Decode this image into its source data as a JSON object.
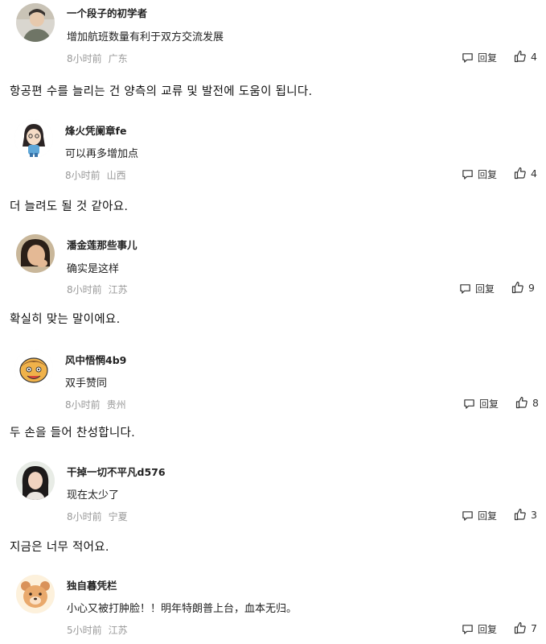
{
  "comments": [
    {
      "username": "一个段子的初学者",
      "text": "增加航班数量有利于双方交流发展",
      "time": "8小时前",
      "location": "广东",
      "reply_label": "回复",
      "likes": "4",
      "translation": "항공편 수를 늘리는 건 양측의 교류 및 발전에 도움이 됩니다."
    },
    {
      "username": "烽火凭阑章fe",
      "text": "可以再多增加点",
      "time": "8小时前",
      "location": "山西",
      "reply_label": "回复",
      "likes": "4",
      "translation": "더 늘려도 될 것 같아요."
    },
    {
      "username": "潘金莲那些事儿",
      "text": "确实是这样",
      "time": "8小时前",
      "location": "江苏",
      "reply_label": "回复",
      "likes": "9",
      "translation": "확실히 맞는 말이에요."
    },
    {
      "username": "风中悟惘4b9",
      "text": "双手赞同",
      "time": "8小时前",
      "location": "贵州",
      "reply_label": "回复",
      "likes": "8",
      "translation": "두 손을 들어 찬성합니다."
    },
    {
      "username": "干掉一切不平凡d576",
      "text": "现在太少了",
      "time": "8小时前",
      "location": "宁夏",
      "reply_label": "回复",
      "likes": "3",
      "translation": "지금은 너무 적어요."
    },
    {
      "username": "独自暮凭栏",
      "text": "小心又被打肿脸！！明年特朗普上台，血本无归。",
      "time": "5小时前",
      "location": "江苏",
      "reply_label": "回复",
      "likes": "7",
      "translation": ""
    }
  ],
  "icons": {
    "reply": "comment-bubble-icon",
    "like": "thumbs-up-icon"
  },
  "colors": {
    "meta": "#999999",
    "text": "#222222"
  }
}
